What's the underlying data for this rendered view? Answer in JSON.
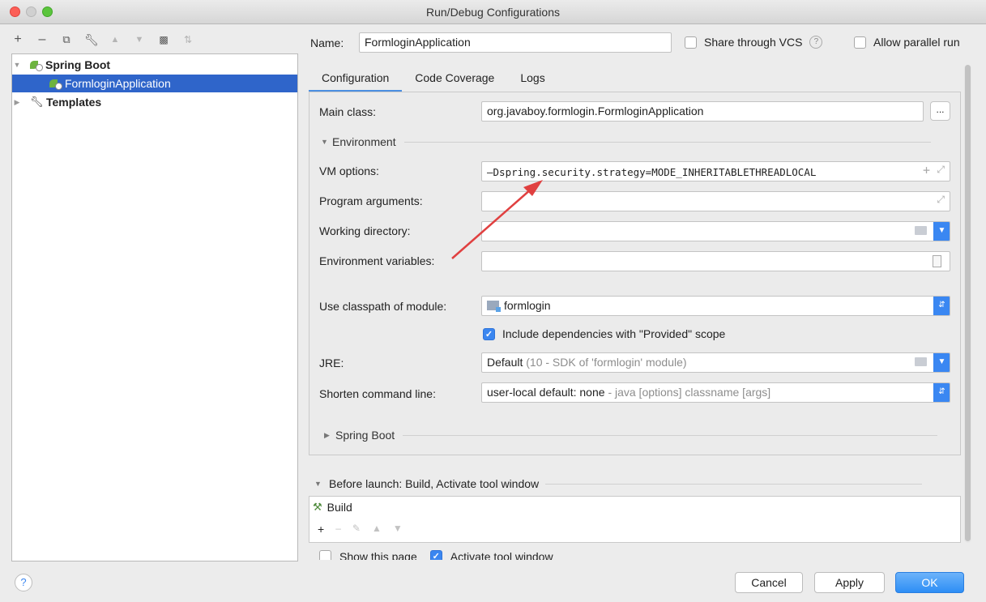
{
  "window": {
    "title": "Run/Debug Configurations"
  },
  "left_toolbar": {
    "icons": [
      "plus-icon",
      "minus-icon",
      "copy-icon",
      "wrench-icon",
      "move-up-icon",
      "move-down-icon",
      "folder-icon",
      "sort-icon"
    ]
  },
  "tree": {
    "group_spring_boot": "Spring Boot",
    "selected_item": "FormloginApplication",
    "group_templates": "Templates"
  },
  "header": {
    "name_label": "Name:",
    "name_value": "FormloginApplication",
    "share_vcs_label": "Share through VCS",
    "share_vcs_checked": false,
    "allow_parallel_label": "Allow parallel run",
    "allow_parallel_checked": false
  },
  "tabs": [
    "Configuration",
    "Code Coverage",
    "Logs"
  ],
  "active_tab": "Configuration",
  "config": {
    "main_class_label": "Main class:",
    "main_class_value": "org.javaboy.formlogin.FormloginApplication",
    "browse_label": "...",
    "environment_section": "Environment",
    "vm_options_label": "VM options:",
    "vm_options_value": "–Dspring.security.strategy=MODE_INHERITABLETHREADLOCAL",
    "program_args_label": "Program arguments:",
    "program_args_value": "",
    "working_dir_label": "Working directory:",
    "working_dir_value": "",
    "env_vars_label": "Environment variables:",
    "env_vars_value": "",
    "classpath_label": "Use classpath of module:",
    "classpath_value": "formlogin",
    "include_deps_label": "Include dependencies with \"Provided\" scope",
    "include_deps_checked": true,
    "jre_label": "JRE:",
    "jre_value": "Default",
    "jre_hint": "(10 - SDK of 'formlogin' module)",
    "shorten_label": "Shorten command line:",
    "shorten_value": "user-local default: none",
    "shorten_hint": "- java [options] classname [args]",
    "spring_boot_section": "Spring Boot"
  },
  "before_launch": {
    "title": "Before launch: Build, Activate tool window",
    "items": [
      "Build"
    ],
    "show_page_label": "Show this page",
    "show_page_checked": false,
    "activate_tool_label": "Activate tool window",
    "activate_tool_checked": true
  },
  "buttons": {
    "help": "?",
    "cancel": "Cancel",
    "apply": "Apply",
    "ok": "OK"
  },
  "colors": {
    "accent": "#2f65ca",
    "annotation_arrow": "#e04040",
    "primary_button": "#3a8ff5"
  }
}
